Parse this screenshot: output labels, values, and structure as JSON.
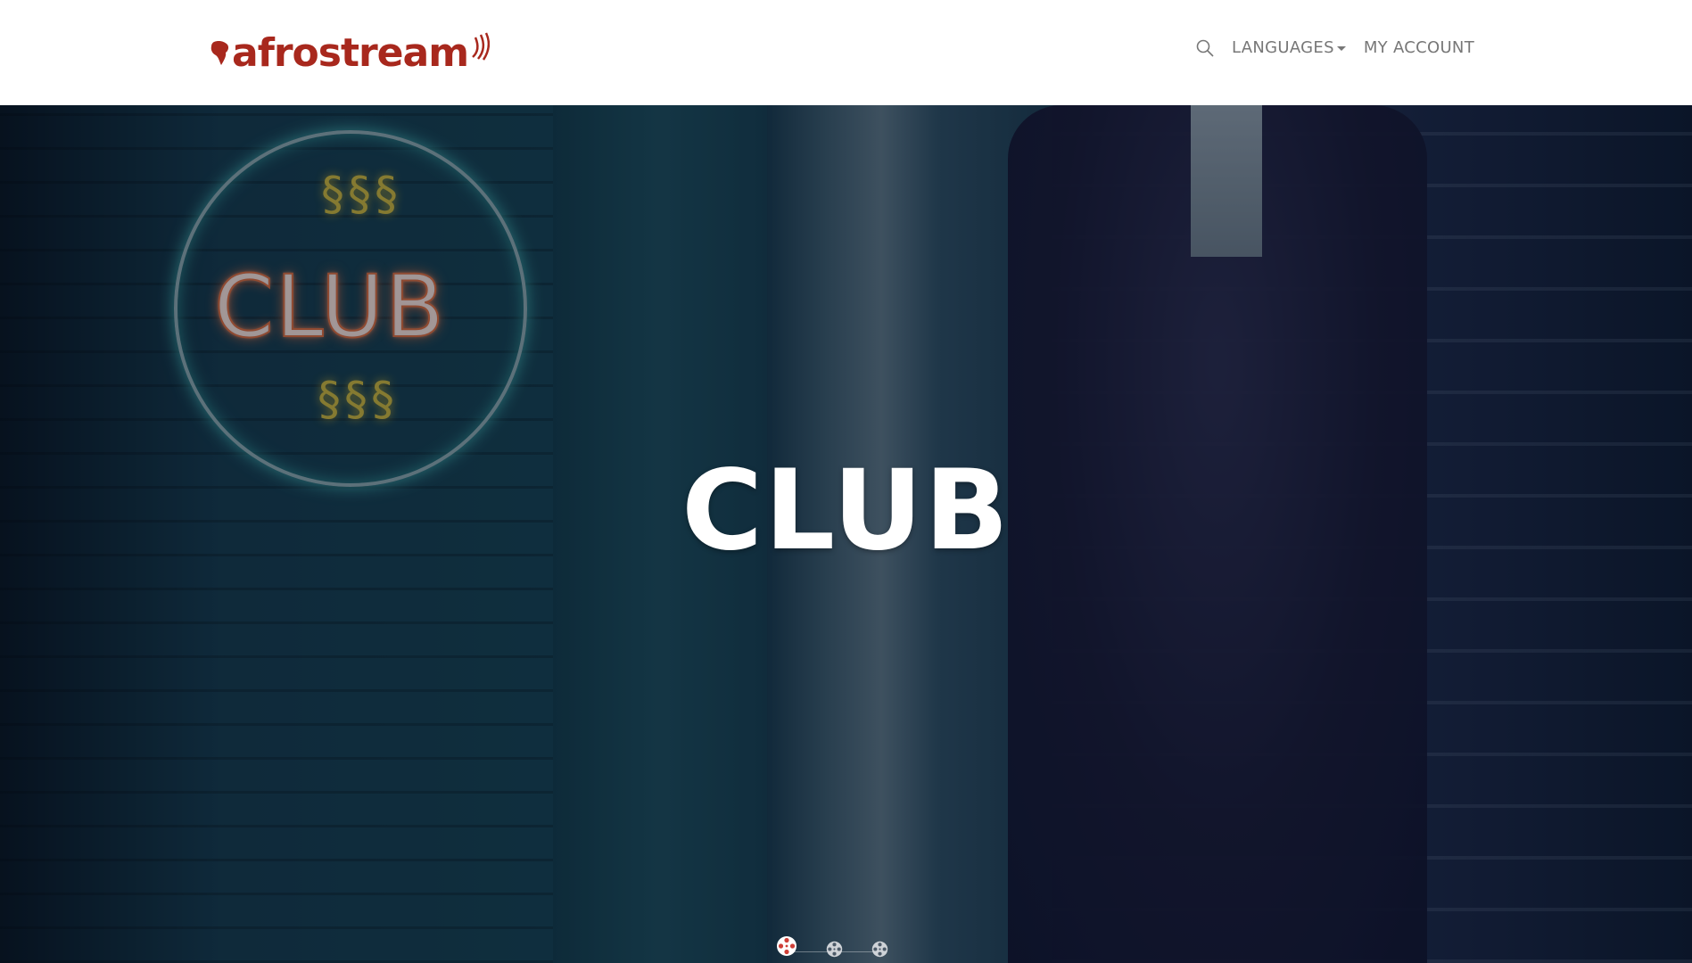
{
  "header": {
    "brand": "afrostream",
    "nav": {
      "languages_label": "LANGUAGES",
      "account_label": "MY ACCOUNT"
    }
  },
  "hero": {
    "title": "CLUB",
    "sign_text": "CLUB",
    "carousel": {
      "slide_count": 3,
      "active_index": 0
    }
  },
  "colors": {
    "brand": "#a8281d",
    "nav_text": "#777777",
    "hero_title": "#ffffff"
  },
  "icons": [
    "afrostream-logo",
    "search-icon",
    "caret-down-icon",
    "film-reel-icon"
  ]
}
